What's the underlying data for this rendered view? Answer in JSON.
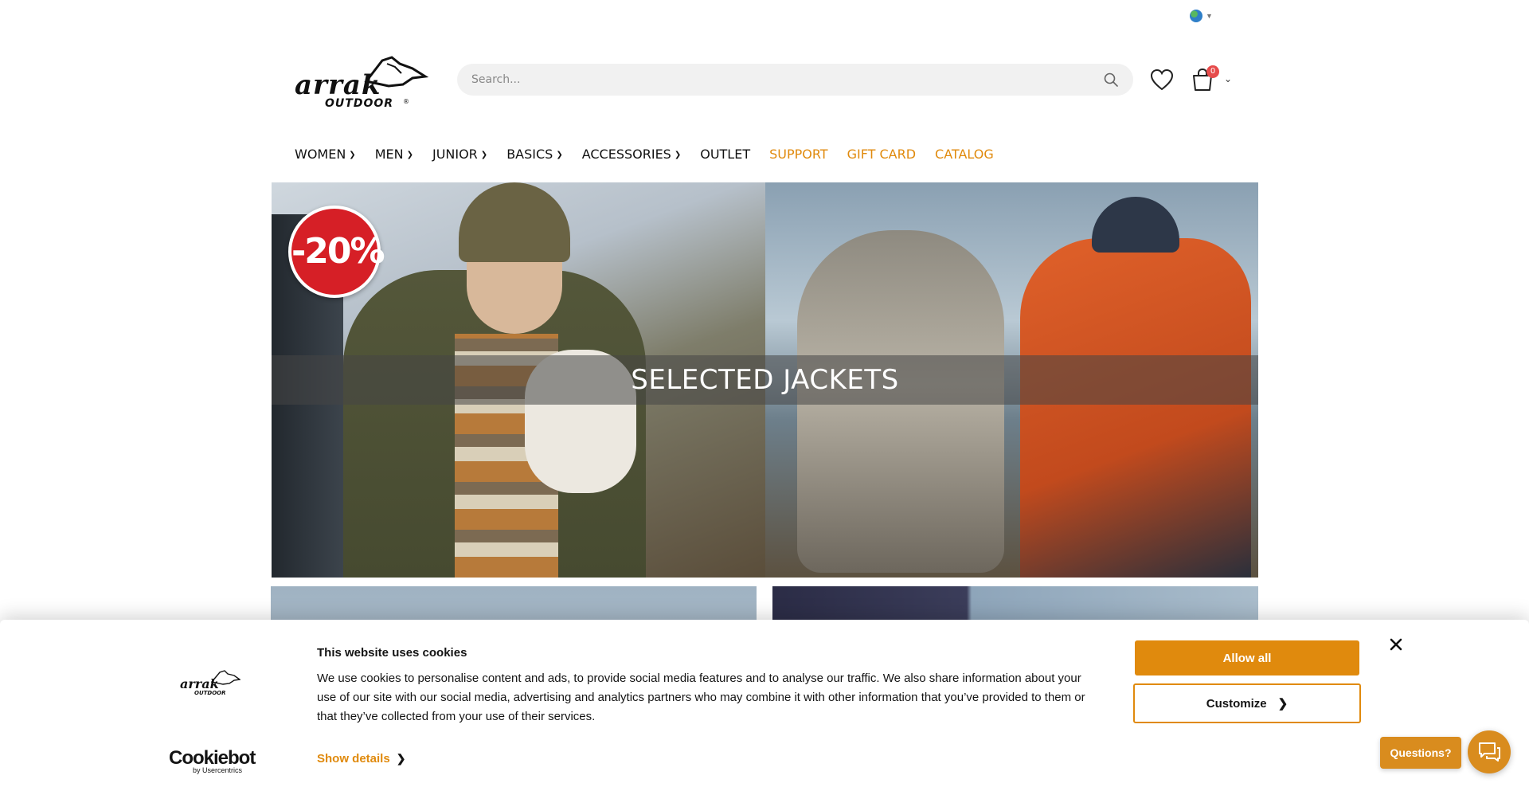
{
  "header": {
    "logo_text": "arrak OUTDOOR",
    "search_placeholder": "Search...",
    "cart_count": "0"
  },
  "nav": {
    "items": [
      {
        "label": "WOMEN",
        "has_dropdown": true,
        "highlight": false
      },
      {
        "label": "MEN",
        "has_dropdown": true,
        "highlight": false
      },
      {
        "label": "JUNIOR",
        "has_dropdown": true,
        "highlight": false
      },
      {
        "label": "BASICS",
        "has_dropdown": true,
        "highlight": false
      },
      {
        "label": "ACCESSORIES",
        "has_dropdown": true,
        "highlight": false
      },
      {
        "label": "OUTLET",
        "has_dropdown": false,
        "highlight": false
      },
      {
        "label": "SUPPORT",
        "has_dropdown": false,
        "highlight": true
      },
      {
        "label": "GIFT CARD",
        "has_dropdown": false,
        "highlight": true
      },
      {
        "label": "CATALOG",
        "has_dropdown": false,
        "highlight": true
      }
    ]
  },
  "hero": {
    "title": "SELECTED JACKETS",
    "badge": "-20%"
  },
  "cookie": {
    "title": "This website uses cookies",
    "text": "We use cookies to personalise content and ads, to provide social media features and to analyse our traffic. We also share information about your use of our site with our social media, advertising and analytics partners who may combine it with other information that you’ve provided to them or that they’ve collected from your use of their services.",
    "show_details": "Show details",
    "allow_all": "Allow all",
    "customize": "Customize",
    "provider_name": "Cookiebot",
    "provider_sub": "by Usercentrics"
  },
  "support_widget": {
    "label": "Questions?"
  },
  "colors": {
    "accent": "#e08a0d",
    "badge_red": "#d61f26",
    "cart_badge": "#e64b4b"
  },
  "icons": [
    "globe-icon",
    "search-icon",
    "heart-icon",
    "cart-icon",
    "close-icon",
    "chat-icon"
  ]
}
